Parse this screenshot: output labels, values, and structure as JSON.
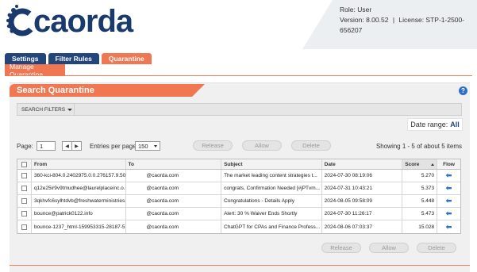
{
  "brand": {
    "name": "caorda",
    "logo_color": "#1a3a6e"
  },
  "account": {
    "role": "Role: User",
    "version": "Version: 8.00.52",
    "license": "License: STP-1-2500-656207",
    "separator": "|"
  },
  "nav": {
    "tabs": [
      {
        "label": "Settings",
        "active": false
      },
      {
        "label": "Filter Rules",
        "active": false
      },
      {
        "label": "Quarantine",
        "active": true
      }
    ],
    "subnav": {
      "label": "Manage Quarantine"
    }
  },
  "panel": {
    "title": "Search Quarantine",
    "help_icon": "?",
    "filters_label": "SEARCH FILTERS",
    "date_range_label": "Date range:",
    "date_range_value": "All"
  },
  "controls": {
    "page_label": "Page:",
    "page_value": "1",
    "pager_prev": "◀",
    "pager_next": "▶",
    "entries_label": "Entries per page:",
    "entries_value": "150",
    "showing": "Showing 1 - 5 of about 5 items"
  },
  "actions": {
    "release": "Release",
    "allow": "Allow",
    "delete": "Delete"
  },
  "grid": {
    "columns": [
      "From",
      "To",
      "Subject",
      "Date",
      "Score",
      "Flow"
    ],
    "sorted_column": "Score",
    "rows": [
      {
        "from": "360-kci-804.0.2402975.0.0.276157.9.50...",
        "to": "@caorda.com",
        "subject": "The market leading content strategies t...",
        "date": "2024-07-30 08:19:06",
        "score": "5.270"
      },
      {
        "from": "q12e25ir9v9tmudhee@laurelplaceinc.o...",
        "to": "@caorda.com",
        "subject": "congrats, Confirmation Needed [#jPTvm...",
        "date": "2024-07-31 10:43:21",
        "score": "5.373"
      },
      {
        "from": "3qkhvfc6sylhtdvb@freshwaterministries...",
        "to": "@caorda.com",
        "subject": "Congratulations - Details Apply",
        "date": "2024-08-05 09:58:09",
        "score": "5.448"
      },
      {
        "from": "bounce@patrick0122.info",
        "to": "@caorda.com",
        "subject": "Alert: 30 % Waiver Ends Shortly",
        "date": "2024-07-30 11:26:17",
        "score": "5.473"
      },
      {
        "from": "bounce-1237_html-159953315-28187-5...",
        "to": "@caorda.com",
        "subject": "ChatGPT for CPAs and Finance Profess...",
        "date": "2024-08-06 07:03:37",
        "score": "15.028"
      }
    ]
  },
  "colors": {
    "accent": "#f07752",
    "nav": "#23457e",
    "link_blue": "#2f6fc9"
  }
}
